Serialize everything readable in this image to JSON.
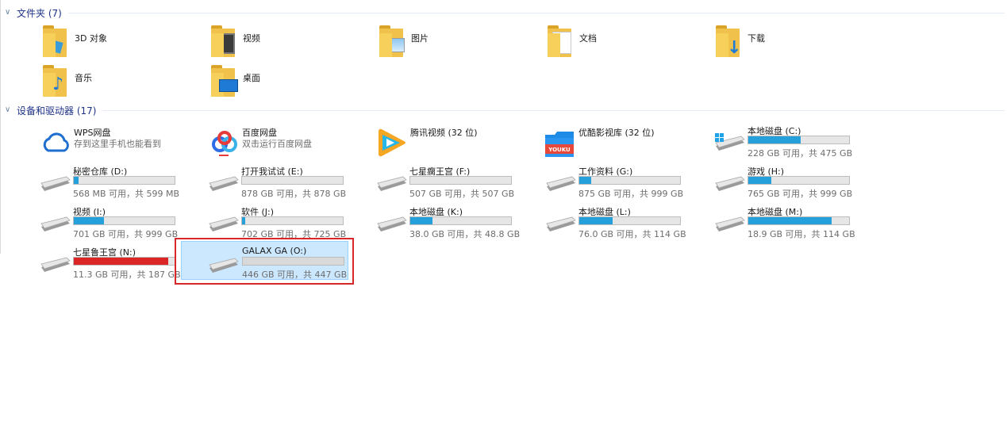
{
  "groups": {
    "folders_title": "文件夹 (7)",
    "devices_title": "设备和驱动器 (17)"
  },
  "folders": [
    {
      "label": "3D 对象",
      "icon": "3d-objects-folder-icon"
    },
    {
      "label": "视频",
      "icon": "videos-folder-icon"
    },
    {
      "label": "图片",
      "icon": "pictures-folder-icon"
    },
    {
      "label": "文档",
      "icon": "documents-folder-icon"
    },
    {
      "label": "下载",
      "icon": "downloads-folder-icon"
    },
    {
      "label": "音乐",
      "icon": "music-folder-icon"
    },
    {
      "label": "桌面",
      "icon": "desktop-folder-icon"
    }
  ],
  "cloud": [
    {
      "name": "WPS网盘",
      "sub": "存到这里手机也能看到",
      "icon": "wps-cloud-icon"
    },
    {
      "name": "百度网盘",
      "sub": "双击运行百度网盘",
      "icon": "baidu-netdisk-icon"
    }
  ],
  "apps": [
    {
      "name": "腾讯视频 (32 位)",
      "icon": "tencent-video-icon"
    },
    {
      "name": "优酷影视库 (32 位)",
      "icon": "youku-icon",
      "logo_text": "YOUKU"
    }
  ],
  "drives": [
    {
      "name": "本地磁盘 (C:)",
      "size": "228 GB 可用，共 475 GB",
      "used_fraction": 0.52
    },
    {
      "name": "秘密仓库 (D:)",
      "size": "568 MB 可用，共 599 MB",
      "used_fraction": 0.05
    },
    {
      "name": "打开我试试 (E:)",
      "size": "878 GB 可用，共 878 GB",
      "used_fraction": 0.0
    },
    {
      "name": "七星瘸王宫 (F:)",
      "size": "507 GB 可用，共 507 GB",
      "used_fraction": 0.0
    },
    {
      "name": "工作资料 (G:)",
      "size": "875 GB 可用，共 999 GB",
      "used_fraction": 0.12
    },
    {
      "name": "游戏 (H:)",
      "size": "765 GB 可用，共 999 GB",
      "used_fraction": 0.23
    },
    {
      "name": "视频 (I:)",
      "size": "701 GB 可用，共 999 GB",
      "used_fraction": 0.3
    },
    {
      "name": "软件 (J:)",
      "size": "702 GB 可用，共 725 GB",
      "used_fraction": 0.03
    },
    {
      "name": "本地磁盘  (K:)",
      "size": "38.0 GB 可用，共 48.8 GB",
      "used_fraction": 0.22
    },
    {
      "name": "本地磁盘 (L:)",
      "size": "76.0 GB 可用，共 114 GB",
      "used_fraction": 0.33
    },
    {
      "name": "本地磁盘 (M:)",
      "size": "18.9 GB 可用，共 114 GB",
      "used_fraction": 0.83
    },
    {
      "name": "七星鲁王宫 (N:)",
      "size": "11.3 GB 可用，共 187 GB",
      "used_fraction": 0.94,
      "nearly_full": true
    },
    {
      "name": "GALAX GA (O:)",
      "size": "446 GB 可用，共 447 GB",
      "used_fraction": 0.0,
      "selected": true
    }
  ],
  "colors": {
    "bar_fill": "#26a0da",
    "bar_full": "#da2626",
    "selection_bg": "#cce8ff",
    "highlight_box": "#d62828",
    "group_title": "#1e3287"
  }
}
